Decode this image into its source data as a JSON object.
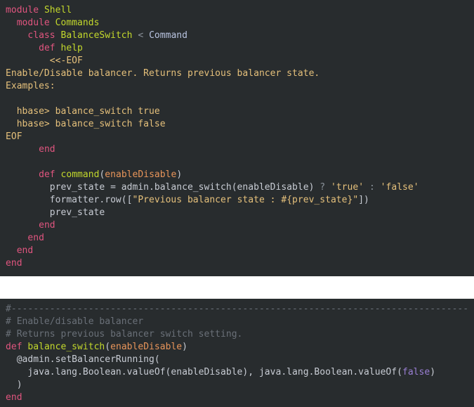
{
  "window": {
    "background": "#ffffff",
    "panel_background": "#282c2e",
    "font_size_px": 13,
    "line_height_px": 18
  },
  "palette": {
    "keyword": "#e0557f",
    "method_name": "#c3d82c",
    "constant": "#b9c4e0",
    "operator": "#8c939b",
    "parameter": "#e8955a",
    "string": "#e5c07b",
    "plain_text": "#c8ccd4",
    "comment": "#6a7078",
    "literal": "#9a7fd4"
  },
  "panels": [
    {
      "name": "ruby-shell-command-panel",
      "language": "ruby",
      "lines": [
        {
          "id": "t1",
          "tokens": [
            {
              "t": "module",
              "c": "kw"
            },
            {
              "t": " ",
              "c": "plain"
            },
            {
              "t": "Shell",
              "c": "cname"
            }
          ]
        },
        {
          "id": "t2",
          "tokens": [
            {
              "t": "  ",
              "c": "plain"
            },
            {
              "t": "module",
              "c": "kw"
            },
            {
              "t": " ",
              "c": "plain"
            },
            {
              "t": "Commands",
              "c": "cname"
            }
          ]
        },
        {
          "id": "t3",
          "tokens": [
            {
              "t": "    ",
              "c": "plain"
            },
            {
              "t": "class",
              "c": "kw"
            },
            {
              "t": " ",
              "c": "plain"
            },
            {
              "t": "BalanceSwitch",
              "c": "cname"
            },
            {
              "t": " ",
              "c": "plain"
            },
            {
              "t": "<",
              "c": "op"
            },
            {
              "t": " ",
              "c": "plain"
            },
            {
              "t": "Command",
              "c": "const"
            }
          ]
        },
        {
          "id": "t4",
          "tokens": [
            {
              "t": "      ",
              "c": "plain"
            },
            {
              "t": "def",
              "c": "kw"
            },
            {
              "t": " ",
              "c": "plain"
            },
            {
              "t": "help",
              "c": "cname"
            }
          ]
        },
        {
          "id": "t5",
          "tokens": [
            {
              "t": "        ",
              "c": "plain"
            },
            {
              "t": "<<-EOF",
              "c": "str"
            }
          ]
        },
        {
          "id": "t6",
          "tokens": [
            {
              "t": "Enable/Disable balancer. Returns previous balancer state.",
              "c": "str"
            }
          ]
        },
        {
          "id": "t7",
          "tokens": [
            {
              "t": "Examples:",
              "c": "str"
            }
          ]
        },
        {
          "id": "t8",
          "tokens": [
            {
              "t": "",
              "c": "str"
            }
          ]
        },
        {
          "id": "t9",
          "tokens": [
            {
              "t": "  hbase> balance_switch true",
              "c": "str"
            }
          ]
        },
        {
          "id": "t10",
          "tokens": [
            {
              "t": "  hbase> balance_switch false",
              "c": "str"
            }
          ]
        },
        {
          "id": "t11",
          "tokens": [
            {
              "t": "EOF",
              "c": "str"
            }
          ]
        },
        {
          "id": "t12",
          "tokens": [
            {
              "t": "      ",
              "c": "plain"
            },
            {
              "t": "end",
              "c": "kw"
            }
          ]
        },
        {
          "id": "t13",
          "tokens": [
            {
              "t": "",
              "c": "plain"
            }
          ]
        },
        {
          "id": "t14",
          "tokens": [
            {
              "t": "      ",
              "c": "plain"
            },
            {
              "t": "def",
              "c": "kw"
            },
            {
              "t": " ",
              "c": "plain"
            },
            {
              "t": "command",
              "c": "cname"
            },
            {
              "t": "(",
              "c": "punc"
            },
            {
              "t": "enableDisable",
              "c": "param"
            },
            {
              "t": ")",
              "c": "punc"
            }
          ]
        },
        {
          "id": "t15",
          "tokens": [
            {
              "t": "        prev_state = admin.balance_switch(enableDisable) ",
              "c": "plain"
            },
            {
              "t": "?",
              "c": "op"
            },
            {
              "t": " ",
              "c": "plain"
            },
            {
              "t": "'true'",
              "c": "str"
            },
            {
              "t": " ",
              "c": "plain"
            },
            {
              "t": ":",
              "c": "op"
            },
            {
              "t": " ",
              "c": "plain"
            },
            {
              "t": "'false'",
              "c": "str"
            }
          ]
        },
        {
          "id": "t16",
          "tokens": [
            {
              "t": "        formatter.row([",
              "c": "plain"
            },
            {
              "t": "\"Previous balancer state : #{prev_state}\"",
              "c": "str"
            },
            {
              "t": "])",
              "c": "plain"
            }
          ]
        },
        {
          "id": "t17",
          "tokens": [
            {
              "t": "        prev_state",
              "c": "plain"
            }
          ]
        },
        {
          "id": "t18",
          "tokens": [
            {
              "t": "      ",
              "c": "plain"
            },
            {
              "t": "end",
              "c": "kw"
            }
          ]
        },
        {
          "id": "t19",
          "tokens": [
            {
              "t": "    ",
              "c": "plain"
            },
            {
              "t": "end",
              "c": "kw"
            }
          ]
        },
        {
          "id": "t20",
          "tokens": [
            {
              "t": "  ",
              "c": "plain"
            },
            {
              "t": "end",
              "c": "kw"
            }
          ]
        },
        {
          "id": "t21",
          "tokens": [
            {
              "t": "end",
              "c": "kw"
            }
          ]
        }
      ]
    },
    {
      "name": "ruby-admin-balance-switch-panel",
      "language": "ruby",
      "lines": [
        {
          "id": "b1",
          "tokens": [
            {
              "t": "#-----------------------------------------------------------------------------------",
              "c": "cmt"
            }
          ]
        },
        {
          "id": "b2",
          "tokens": [
            {
              "t": "# Enable/disable balancer",
              "c": "cmt"
            }
          ]
        },
        {
          "id": "b3",
          "tokens": [
            {
              "t": "# Returns previous balancer switch setting.",
              "c": "cmt"
            }
          ]
        },
        {
          "id": "b4",
          "tokens": [
            {
              "t": "def",
              "c": "kw"
            },
            {
              "t": " ",
              "c": "plain"
            },
            {
              "t": "balance_switch",
              "c": "cname"
            },
            {
              "t": "(",
              "c": "punc"
            },
            {
              "t": "enableDisable",
              "c": "param"
            },
            {
              "t": ")",
              "c": "punc"
            }
          ]
        },
        {
          "id": "b5",
          "tokens": [
            {
              "t": "  @admin.setBalancerRunning(",
              "c": "plain"
            }
          ]
        },
        {
          "id": "b6",
          "tokens": [
            {
              "t": "    java.lang.Boolean.valueOf(enableDisable), java.lang.Boolean.valueOf(",
              "c": "plain"
            },
            {
              "t": "false",
              "c": "lit"
            },
            {
              "t": ")",
              "c": "plain"
            }
          ]
        },
        {
          "id": "b7",
          "tokens": [
            {
              "t": "  )",
              "c": "plain"
            }
          ]
        },
        {
          "id": "b8",
          "tokens": [
            {
              "t": "end",
              "c": "kw"
            }
          ]
        }
      ]
    }
  ]
}
